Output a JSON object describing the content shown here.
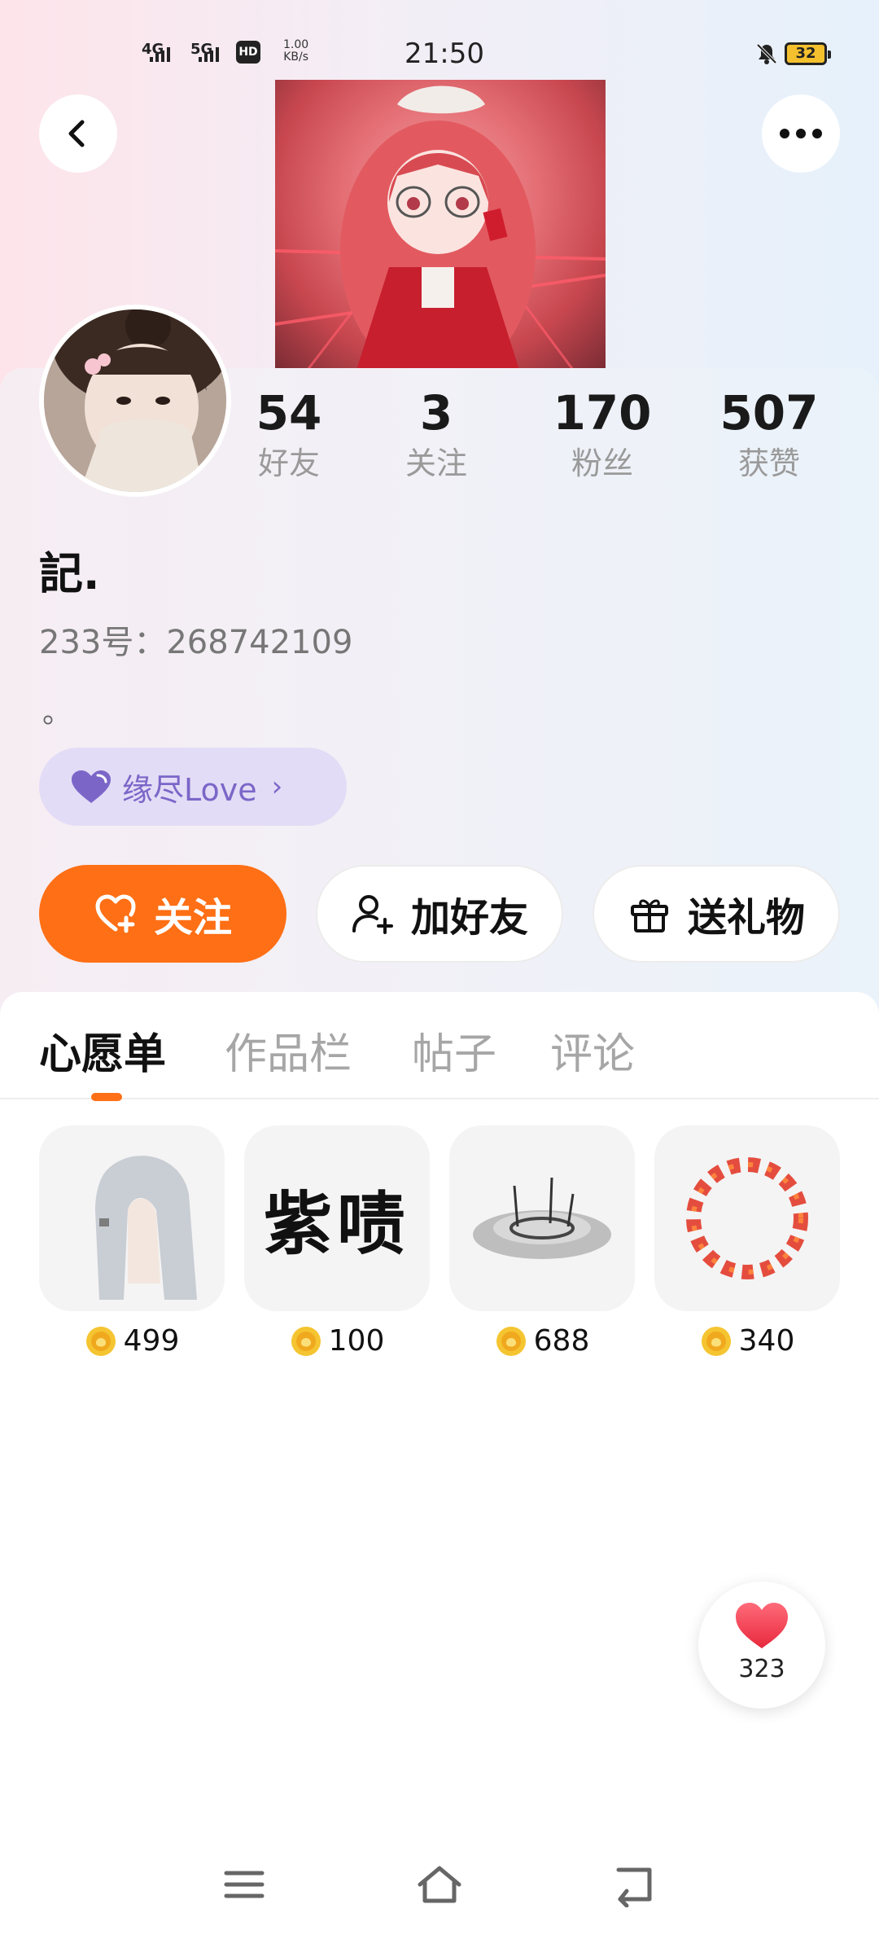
{
  "status_bar": {
    "network1": "4G",
    "network2": "5G",
    "hd": "HD",
    "speed_value": "1.00",
    "speed_unit": "KB/s",
    "time": "21:50",
    "battery": "32"
  },
  "header": {
    "back_icon": "chevron-left-icon",
    "more_icon": "more-dots-icon"
  },
  "profile": {
    "stats": [
      {
        "value": "54",
        "label": "好友"
      },
      {
        "value": "3",
        "label": "关注"
      },
      {
        "value": "170",
        "label": "粉丝"
      },
      {
        "value": "507",
        "label": "获赞"
      }
    ],
    "nickname": "記.",
    "uid": "233号：268742109",
    "bio": "。",
    "tag_label": "缘尽Love",
    "tag_chevron": "›"
  },
  "actions": {
    "follow": "关注",
    "add_friend": "加好友",
    "send_gift": "送礼物"
  },
  "tabs": [
    {
      "label": "心愿单"
    },
    {
      "label": "作品栏"
    },
    {
      "label": "帖子"
    },
    {
      "label": "评论"
    }
  ],
  "wishlist": [
    {
      "name": "hair-item",
      "price": "499"
    },
    {
      "name": "text-item",
      "price": "100",
      "text": "紫啧"
    },
    {
      "name": "effect-item",
      "price": "688"
    },
    {
      "name": "ring-item",
      "price": "340"
    }
  ],
  "fab": {
    "count": "323"
  },
  "colors": {
    "accent": "#ff6f15",
    "tag_bg": "#e3dcf6",
    "tag_text": "#7b66c8"
  }
}
